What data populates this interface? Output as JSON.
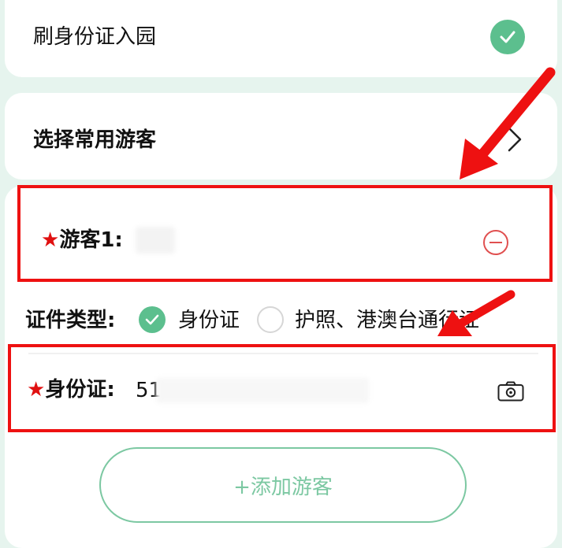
{
  "swipe_id": {
    "label": "刷身份证入园",
    "checked": true
  },
  "select_visitor": {
    "label": "选择常用游客"
  },
  "visitor": {
    "star": "★",
    "label": "游客1:",
    "name_masked": ""
  },
  "cert_type": {
    "label": "证件类型:",
    "options": [
      {
        "label": "身份证",
        "selected": true
      },
      {
        "label": "护照、港澳台通行证",
        "selected": false
      }
    ]
  },
  "id_card": {
    "star": "★",
    "label": "身份证:",
    "value_visible": "51"
  },
  "add_visitor": {
    "label": "+添加游客"
  },
  "colors": {
    "accent_green": "#5cbf8e",
    "annotation_red": "#ee1111",
    "remove_red": "#e05050",
    "background": "#e6f4ee"
  },
  "icons": {
    "check": "check-icon",
    "chevron": "chevron-right-icon",
    "remove": "minus-circle-icon",
    "camera": "camera-icon"
  }
}
